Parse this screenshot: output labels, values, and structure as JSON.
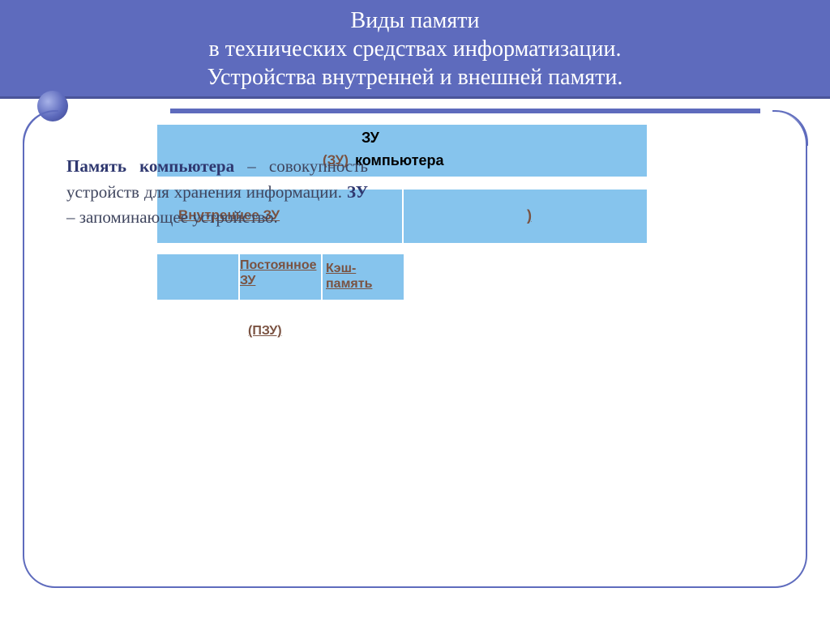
{
  "header": {
    "line1": "Виды памяти",
    "line2": "в технических средствах информатизации.",
    "line3": "Устройства внутренней и внешней памяти."
  },
  "paragraph": {
    "part1": "Память компьютера",
    "dash1": " – ",
    "part2": "(ЗУ)",
    "part3": " совокупность устройств для хранения информации. ",
    "part4": "ЗУ",
    "dash2": " – ",
    "part5": "запоминающее устройство."
  },
  "diagram": {
    "top1": "ЗУ",
    "top2a": "(ЗУ)",
    "top2b": "компьютера",
    "midLeft": "Внутреннее ЗУ",
    "midZu": "ЗУ",
    "rightParen": ")",
    "post": "Постоянное ЗУ",
    "cache": "Кэш-память",
    "pzu": "(ПЗУ)"
  }
}
